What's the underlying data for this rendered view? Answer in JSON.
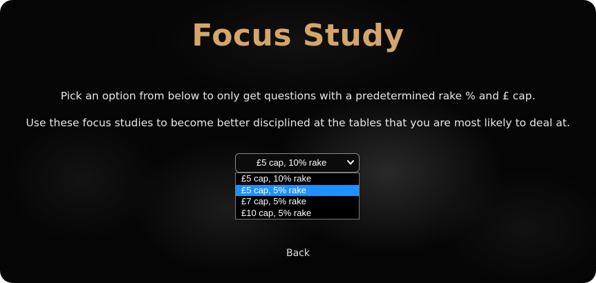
{
  "page": {
    "title": "Focus Study",
    "description_line1": "Pick an option from below to only get questions with a predetermined rake % and £ cap.",
    "description_line2": "Use these focus studies to become better disciplined at the tables that you are most likely to deal at."
  },
  "select": {
    "selected_value": "£5 cap, 10% rake",
    "icon": "chevron-down-icon",
    "options": [
      {
        "label": "£5 cap, 10% rake"
      },
      {
        "label": "£5 cap, 5% rake",
        "highlighted": true
      },
      {
        "label": "£7 cap, 5% rake"
      },
      {
        "label": "£10 cap, 5% rake"
      }
    ]
  },
  "nav": {
    "back_label": "Back"
  },
  "colors": {
    "title": "#d4a66a",
    "highlight": "#1e90ff",
    "background": "#050505"
  }
}
